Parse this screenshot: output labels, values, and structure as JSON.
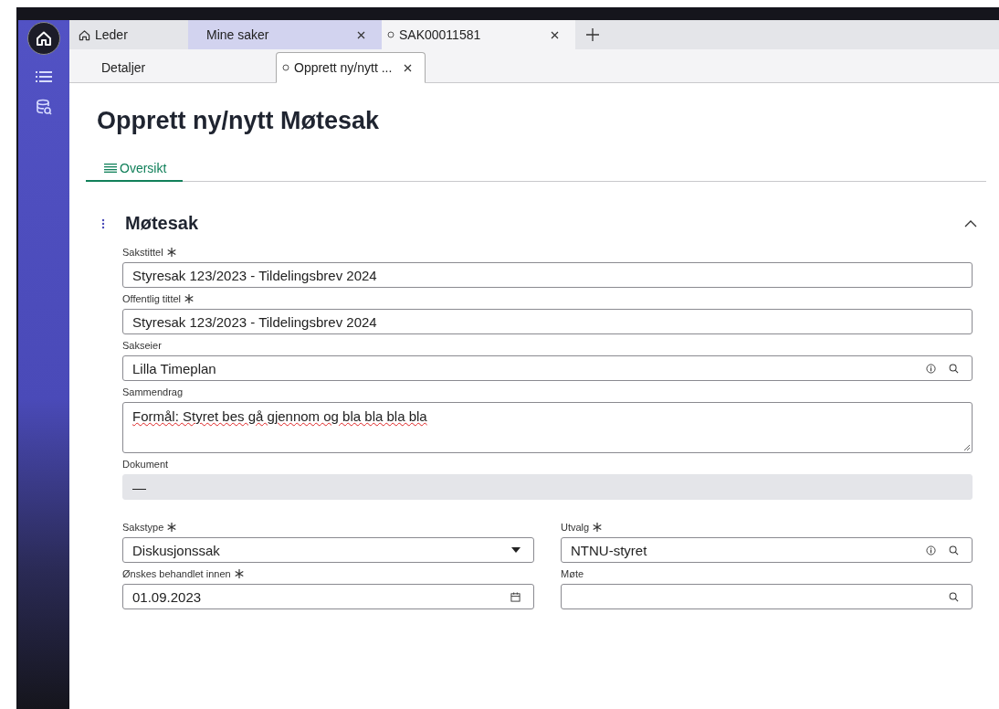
{
  "tabs": [
    {
      "kind": "home",
      "label": "Leder",
      "selected": false,
      "hovered": false
    },
    {
      "kind": "closable",
      "label": "Mine saker",
      "selected": false,
      "hovered": true
    },
    {
      "kind": "document",
      "label": "SAK00011581",
      "selected": true,
      "hovered": false
    }
  ],
  "subtabs": [
    {
      "kind": "plain",
      "label": "Detaljer",
      "selected": false
    },
    {
      "kind": "document",
      "label": "Opprett ny/nytt ...",
      "selected": true
    }
  ],
  "page_title": "Opprett ny/nytt Møtesak",
  "view_tabs": [
    {
      "label": "Oversikt",
      "selected": true
    }
  ],
  "section": {
    "title": "Møtesak",
    "expanded": true,
    "fields": [
      {
        "kind": "text",
        "label": "Sakstittel",
        "required": true,
        "value": "Styresak 123/2023 - Tildelingsbrev 2024"
      },
      {
        "kind": "text",
        "label": "Offentlig tittel",
        "required": true,
        "value": "Styresak 123/2023 - Tildelingsbrev 2024"
      },
      {
        "kind": "lookup",
        "label": "Sakseier",
        "required": false,
        "value": "Lilla Timeplan"
      },
      {
        "kind": "textarea",
        "label": "Sammendrag",
        "required": false,
        "value": "Formål: Styret bes gå gjennom og bla bla bla bla"
      },
      {
        "kind": "readonly",
        "label": "Dokument",
        "required": false,
        "value": "—"
      }
    ],
    "columns": [
      [
        {
          "kind": "select",
          "label": "Sakstype",
          "required": true,
          "value": "Diskusjonssak"
        },
        {
          "kind": "date",
          "label": "Ønskes behandlet innen",
          "required": true,
          "value": "01.09.2023"
        }
      ],
      [
        {
          "kind": "lookup",
          "label": "Utvalg",
          "required": true,
          "value": "NTNU-styret"
        },
        {
          "kind": "search",
          "label": "Møte",
          "required": false
        }
      ]
    ]
  }
}
